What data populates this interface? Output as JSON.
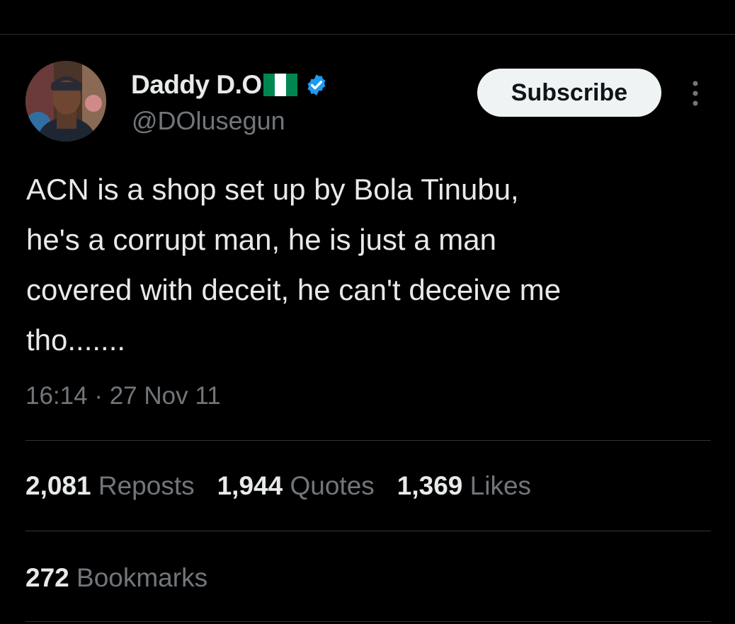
{
  "author": {
    "display_name": "Daddy D.O",
    "handle": "@DOlusegun",
    "flag_colors": [
      "#008751",
      "#ffffff",
      "#008751"
    ],
    "verified_color": "#1d9bf0",
    "avatar_icon": "profile-photo"
  },
  "subscribe_label": "Subscribe",
  "more_icon": "vertical-ellipsis-icon",
  "tweet": {
    "text": "ACN is a shop set up by Bola Tinubu,\nhe's a corrupt man, he is just a man\ncovered with deceit, he can't deceive me\ntho.......",
    "time": "16:14",
    "separator": " · ",
    "date": "27 Nov 11"
  },
  "stats": {
    "reposts": {
      "count": "2,081",
      "label": "Reposts"
    },
    "quotes": {
      "count": "1,944",
      "label": "Quotes"
    },
    "likes": {
      "count": "1,369",
      "label": "Likes"
    },
    "bookmarks": {
      "count": "272",
      "label": "Bookmarks"
    }
  },
  "colors": {
    "background": "#000000",
    "text_primary": "#e7e9ea",
    "text_secondary": "#71767b",
    "divider": "#2f3336"
  }
}
